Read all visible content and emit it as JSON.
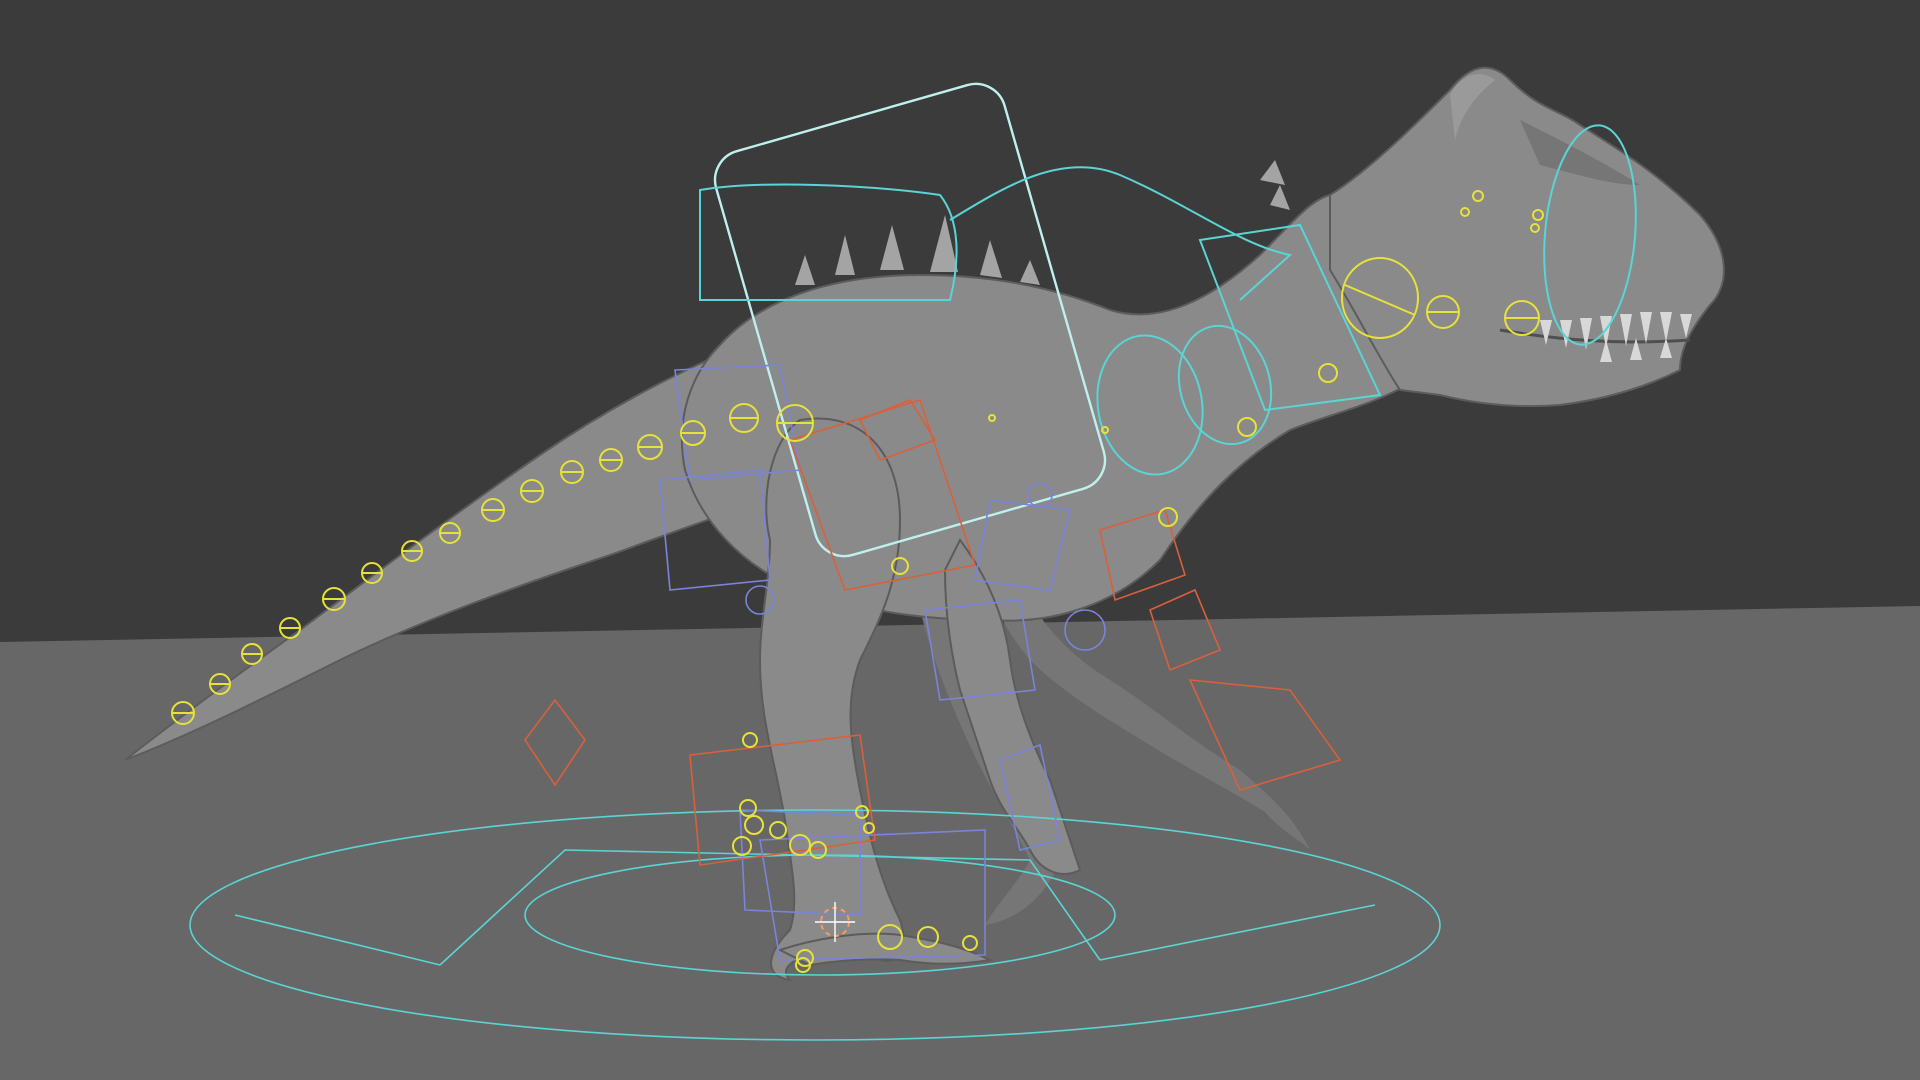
{
  "viewport": {
    "scene": "3d-viewport",
    "background_color": "#3b3b3b",
    "floor_color": "#676767",
    "mesh_color": "#8a8a8a"
  },
  "rig_colors": {
    "main_controls": "#5ad4d4",
    "body_control": "#bff0ee",
    "fk_controls": "#7a84d8",
    "ik_controls": "#d9603a",
    "deform_bones": "#e6e23a"
  },
  "icons": {
    "pivot": "3d-cursor-icon"
  }
}
